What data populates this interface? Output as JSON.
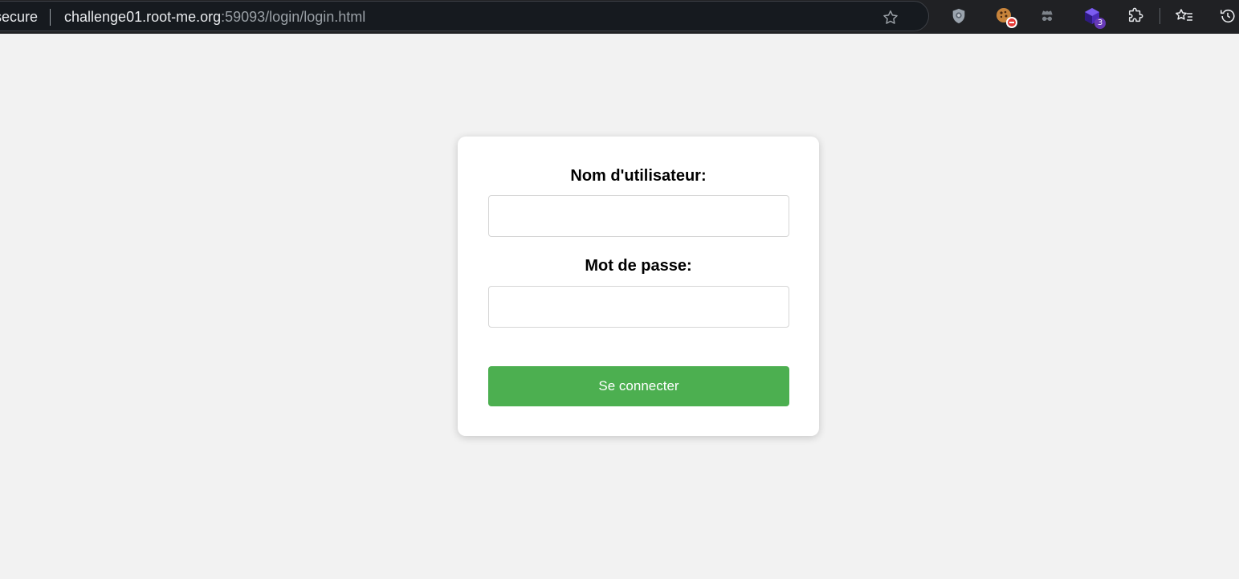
{
  "browser": {
    "security_label": "ot secure",
    "url_host": "challenge01.root-me.org",
    "url_rest": ":59093/login/login.html",
    "icons": [
      "bookmark-star-icon",
      "shield-extension-icon",
      "cookie-block-extension-icon",
      "incognito-extension-icon",
      "cube-extension-icon",
      "extensions-puzzle-icon",
      "reading-list-icon",
      "history-icon"
    ],
    "cube_badge": "3"
  },
  "form": {
    "username_label": "Nom d'utilisateur:",
    "password_label": "Mot de passe:",
    "username_value": "",
    "password_value": "",
    "submit_label": "Se connecter"
  },
  "colors": {
    "page_bg": "#f2f2f2",
    "button_green": "#4caf50",
    "badge_purple": "#673ab7"
  }
}
